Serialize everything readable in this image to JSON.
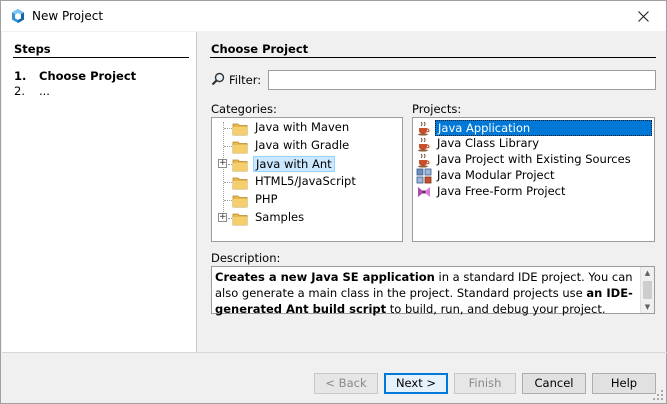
{
  "window": {
    "title": "New Project"
  },
  "steps": {
    "title": "Steps",
    "items": [
      {
        "num": "1.",
        "label": "Choose Project"
      },
      {
        "num": "2.",
        "label": "..."
      }
    ]
  },
  "main": {
    "title": "Choose Project",
    "filter": {
      "label": "Filter:",
      "value": ""
    },
    "categories": {
      "label": "Categories:",
      "items": [
        {
          "label": "Java with Maven",
          "expandable": false,
          "selected": false
        },
        {
          "label": "Java with Gradle",
          "expandable": false,
          "selected": false
        },
        {
          "label": "Java with Ant",
          "expandable": true,
          "selected": true
        },
        {
          "label": "HTML5/JavaScript",
          "expandable": false,
          "selected": false
        },
        {
          "label": "PHP",
          "expandable": false,
          "selected": false
        },
        {
          "label": "Samples",
          "expandable": true,
          "selected": false
        }
      ]
    },
    "projects": {
      "label": "Projects:",
      "items": [
        {
          "label": "Java Application",
          "icon": "java-coffee-cup-icon",
          "selected": true
        },
        {
          "label": "Java Class Library",
          "icon": "java-coffee-cup-icon",
          "selected": false
        },
        {
          "label": "Java Project with Existing Sources",
          "icon": "java-coffee-cup-icon",
          "selected": false
        },
        {
          "label": "Java Modular Project",
          "icon": "java-modular-project-icon",
          "selected": false
        },
        {
          "label": "Java Free-Form Project",
          "icon": "java-freeform-project-icon",
          "selected": false
        }
      ]
    },
    "description": {
      "label": "Description:",
      "parts": [
        {
          "text": "Creates a new Java SE application",
          "bold": true
        },
        {
          "text": " in a standard IDE project. You can also generate a main class in the project. Standard projects use ",
          "bold": false
        },
        {
          "text": "an IDE-generated Ant build script",
          "bold": true
        },
        {
          "text": " to build, run, and debug your project.",
          "bold": false
        }
      ]
    }
  },
  "buttons": {
    "back": "< Back",
    "next": "Next >",
    "finish": "Finish",
    "cancel": "Cancel",
    "help": "Help"
  },
  "colors": {
    "selection": "#0078d7",
    "folder": "#e8b84a",
    "java_cup": "#c8502c"
  }
}
